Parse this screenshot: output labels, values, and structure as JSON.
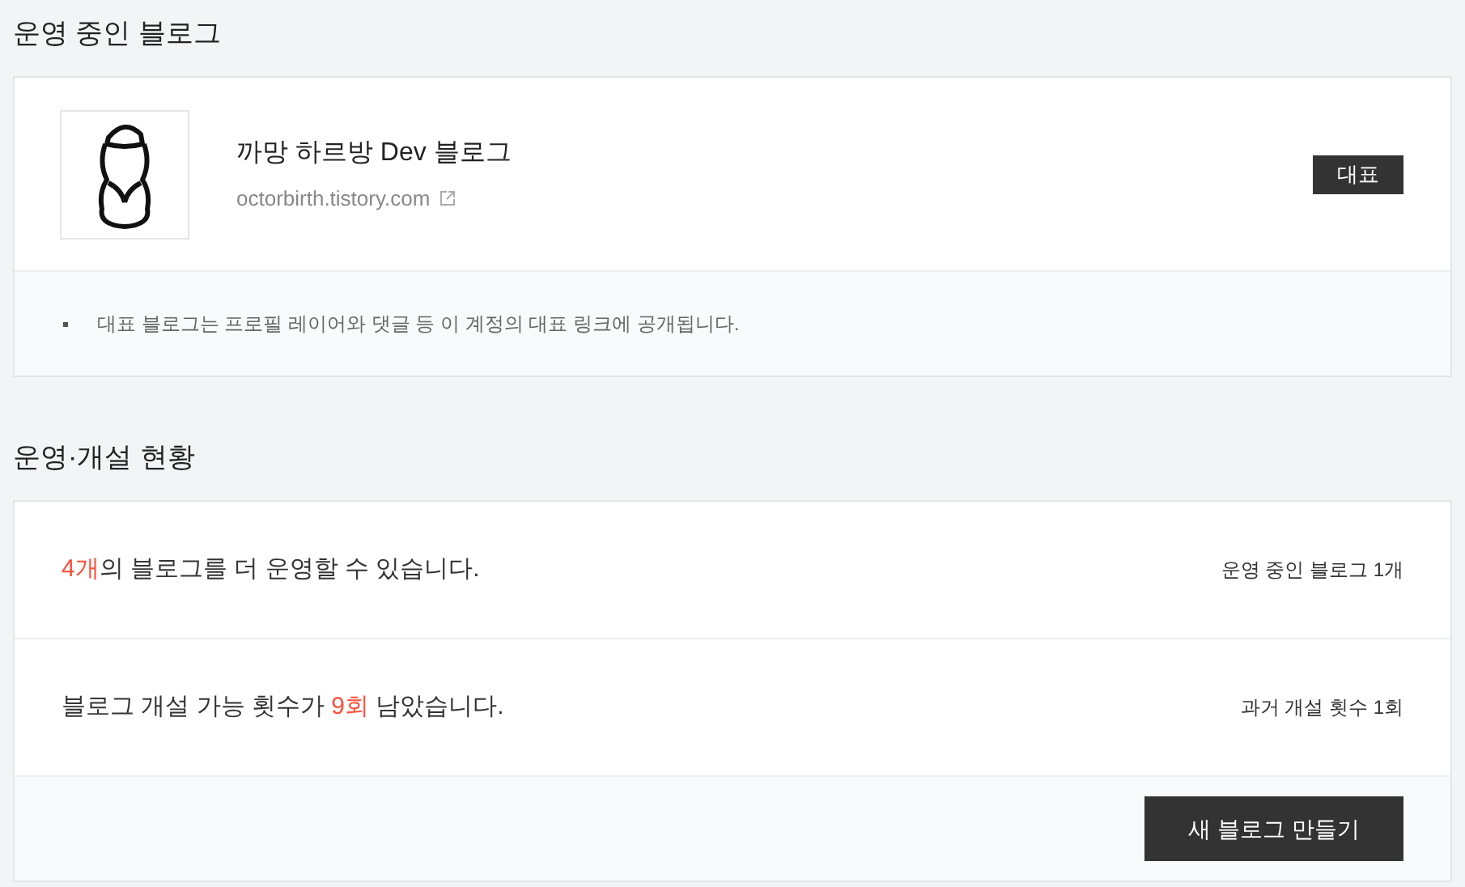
{
  "sections": [
    {
      "title": "운영 중인 블로그"
    },
    {
      "title": "운영·개설 현황"
    }
  ],
  "blog": {
    "name": "까망 하르방 Dev 블로그",
    "url": "octorbirth.tistory.com",
    "badge": "대표",
    "note": "대표 블로그는 프로필 레이어와 댓글 등 이 계정의 대표 링크에 공개됩니다."
  },
  "status_rows": [
    {
      "parts": [
        {
          "text": "4개",
          "highlight": true
        },
        {
          "text": "의 블로그를 더 운영할 수 있습니다.",
          "highlight": false
        }
      ],
      "side": "운영 중인 블로그 1개"
    },
    {
      "parts": [
        {
          "text": "블로그 개설 가능 횟수가 ",
          "highlight": false
        },
        {
          "text": "9회",
          "highlight": true
        },
        {
          "text": " 남았습니다.",
          "highlight": false
        }
      ],
      "side": "과거 개설 횟수 1회"
    }
  ],
  "create_button": "새 블로그 만들기"
}
